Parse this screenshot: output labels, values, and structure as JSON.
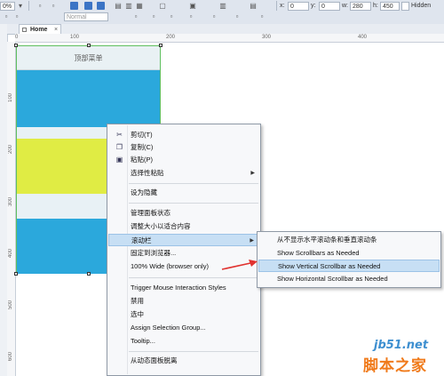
{
  "toolbar": {
    "zoom_value": "0%",
    "style_value": "Normal",
    "x_label": "x:",
    "x_value": "0",
    "y_label": "y:",
    "y_value": "0",
    "w_label": "w:",
    "w_value": "280",
    "h_label": "h:",
    "h_value": "450",
    "hidden_label": "Hidden"
  },
  "tab": {
    "label": "Home",
    "close": "×"
  },
  "ruler_top": [
    "0",
    "100",
    "200",
    "300",
    "400"
  ],
  "ruler_left": [
    "100",
    "200",
    "300",
    "400",
    "500",
    "600"
  ],
  "widget": {
    "title": "顶部菜单"
  },
  "context_menu": {
    "items": [
      {
        "label": "剪切(T)",
        "icon": "scissors-icon"
      },
      {
        "label": "复制(C)",
        "icon": "copy-icon"
      },
      {
        "label": "粘贴(P)",
        "icon": "paste-icon"
      },
      {
        "label": "选择性粘贴",
        "submenu": true
      },
      {
        "label": "设为隐藏"
      },
      {
        "label": "管理面板状态"
      },
      {
        "label": "调整大小以适合内容"
      },
      {
        "label": "滚动栏",
        "submenu": true,
        "highlighted": true
      },
      {
        "label": "固定到浏览器..."
      },
      {
        "label": "100% Wide (browser only)"
      },
      {
        "label": "Trigger Mouse Interaction Styles"
      },
      {
        "label": "禁用"
      },
      {
        "label": "选中"
      },
      {
        "label": "Assign Selection Group..."
      },
      {
        "label": "Tooltip..."
      },
      {
        "label": "从动态面板脱离"
      }
    ]
  },
  "submenu": {
    "items": [
      {
        "label": "从不显示水平滚动条和垂直滚动条"
      },
      {
        "label": "Show Scrollbars as Needed"
      },
      {
        "label": "Show Vertical Scrollbar as Needed",
        "highlighted": true
      },
      {
        "label": "Show Horizontal Scrollbar as Needed"
      }
    ]
  },
  "colors": {
    "panel_blue": "#2ba8dc",
    "panel_yellow": "#e0ec44",
    "highlight": "#c7dff4",
    "arrow": "#e0322f"
  },
  "watermark": {
    "line1": "jb51.net",
    "line2": "脚本之家"
  }
}
